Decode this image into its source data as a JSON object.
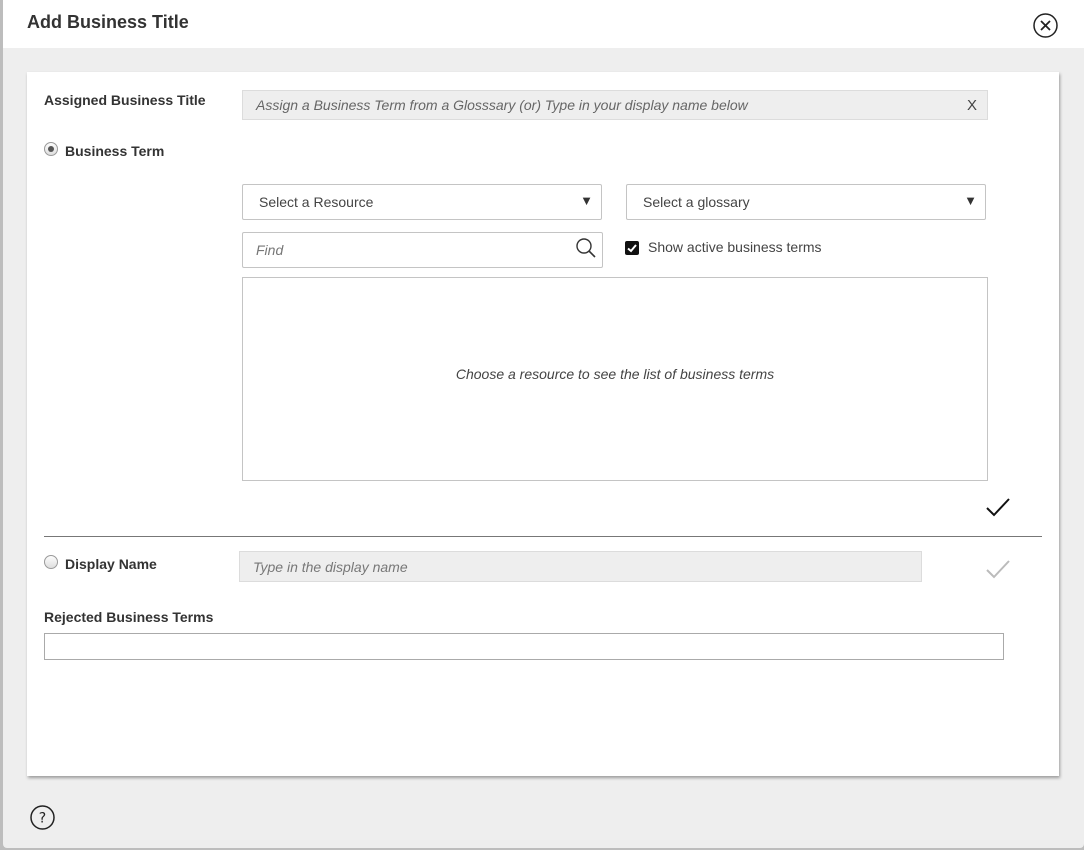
{
  "dialog": {
    "title": "Add Business Title",
    "close_icon": "close-circle-icon",
    "help_icon": "help-circle-icon"
  },
  "form": {
    "assigned_title": {
      "label": "Assigned Business Title",
      "placeholder": "Assign a Business Term from a Glosssary (or) Type in your display name below",
      "clear_label": "X"
    },
    "business_term": {
      "label": "Business Term",
      "selected": true,
      "resource_select": {
        "value": "Select a Resource",
        "caret": "▼"
      },
      "glossary_select": {
        "value": "Select a glossary",
        "caret": "▼"
      },
      "find": {
        "placeholder": "Find",
        "icon": "search-icon"
      },
      "show_active": {
        "label": "Show active business terms",
        "checked": true
      },
      "list_empty_message": "Choose a resource to see the list of business terms",
      "confirm_icon": "checkmark-icon"
    },
    "display_name": {
      "label": "Display Name",
      "selected": false,
      "placeholder": "Type in the display name",
      "confirm_icon": "checkmark-icon"
    },
    "rejected": {
      "label": "Rejected Business Terms",
      "value": ""
    }
  }
}
